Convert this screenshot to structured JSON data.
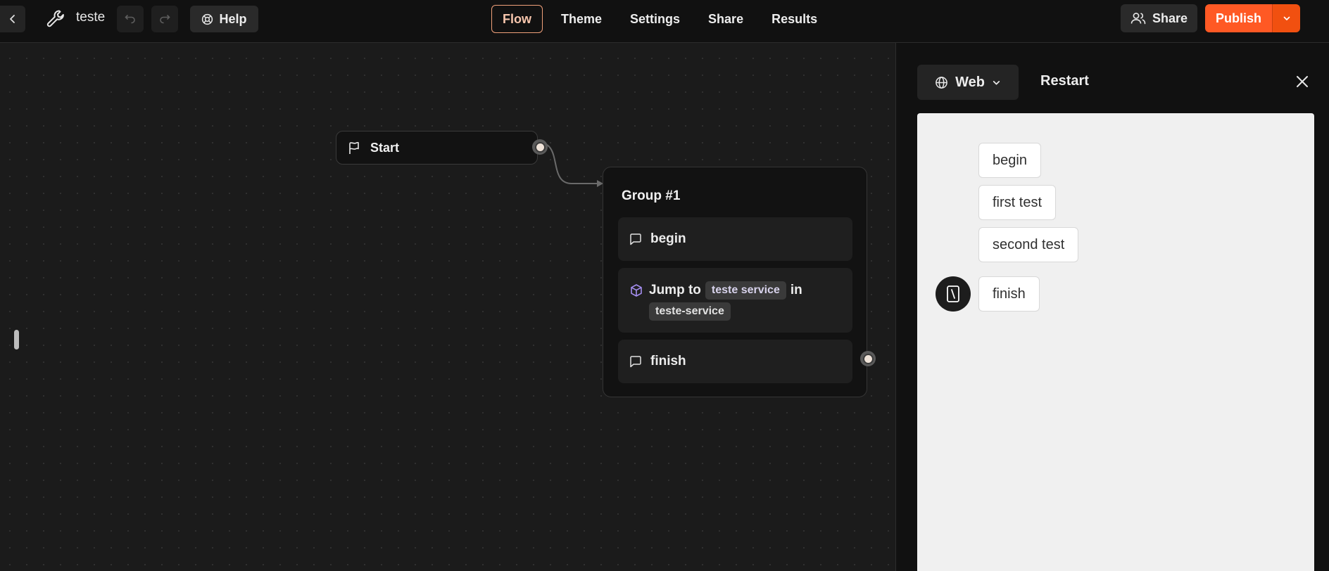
{
  "header": {
    "project_title": "teste",
    "help_label": "Help",
    "nav": [
      {
        "label": "Flow",
        "active": true
      },
      {
        "label": "Theme"
      },
      {
        "label": "Settings"
      },
      {
        "label": "Share"
      },
      {
        "label": "Results"
      }
    ],
    "share_label": "Share",
    "publish_label": "Publish"
  },
  "canvas": {
    "start_node": {
      "label": "Start"
    },
    "group": {
      "title": "Group #1",
      "blocks": {
        "begin": "begin",
        "jump_prefix": "Jump to",
        "jump_target": "teste service",
        "jump_in": "in",
        "jump_bot": "teste-service",
        "finish": "finish"
      }
    }
  },
  "preview": {
    "platform_label": "Web",
    "restart_label": "Restart",
    "messages": [
      "begin",
      "first test",
      "second test",
      "finish"
    ]
  },
  "colors": {
    "accent": "#ff5924",
    "flow_active_border": "#f0a07a",
    "integration_icon": "#a58ef0"
  }
}
